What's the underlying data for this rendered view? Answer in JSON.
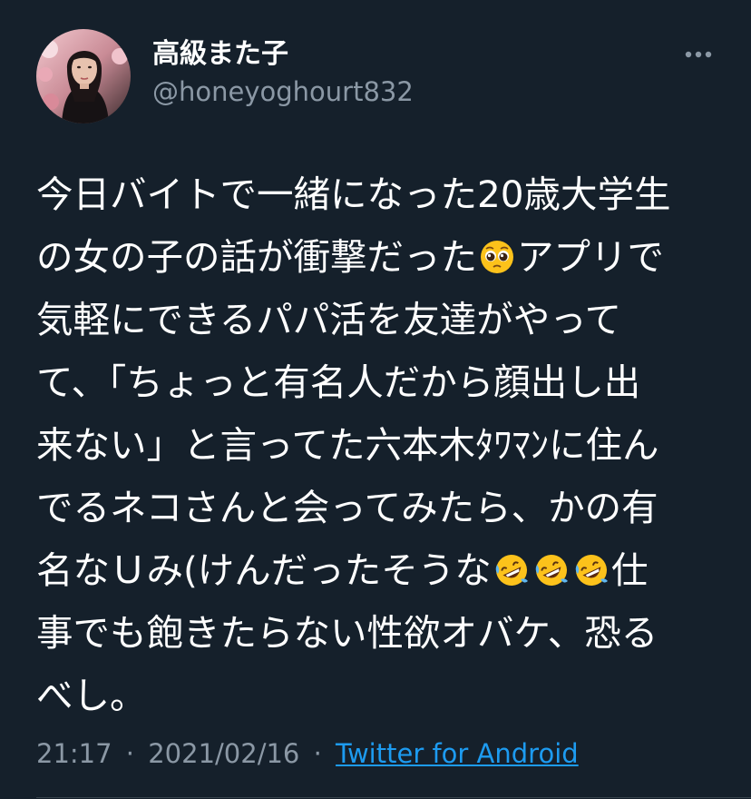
{
  "author": {
    "name": "高級また子",
    "handle": "@honeyoghourt832"
  },
  "tweet": {
    "lines": [
      [
        "今日バイトで一緒になった20歳大学生"
      ],
      [
        "の女の子の話が衝撃だった",
        {
          "emoji": "pleading-face-emoji"
        },
        "アプリで"
      ],
      [
        "気軽にできるパパ活を友達がやって"
      ],
      [
        "て、「ちょっと有名人だから顔出し出"
      ],
      [
        "来ない」と言ってた六本木ﾀﾜﾏﾝに住ん"
      ],
      [
        "でるネコさんと会ってみたら、かの有"
      ],
      [
        "名なＵみ(けんだったそうな",
        {
          "emoji": "rolling-on-the-floor-laughing-emoji"
        },
        {
          "emoji": "rolling-on-the-floor-laughing-emoji"
        },
        {
          "emoji": "rolling-on-the-floor-laughing-emoji"
        },
        "仕"
      ],
      [
        "事でも飽きたらない性欲オバケ、恐る"
      ],
      [
        "べし。"
      ]
    ]
  },
  "meta": {
    "time": "21:17",
    "separator": "·",
    "date": "2021/02/16",
    "source": "Twitter for Android"
  },
  "icons": {
    "more": "more-horizontal-icon"
  },
  "colors": {
    "background": "#15202b",
    "text": "#ffffff",
    "secondary": "#8b98a5",
    "link": "#1d9bf0",
    "divider": "#38444d"
  }
}
